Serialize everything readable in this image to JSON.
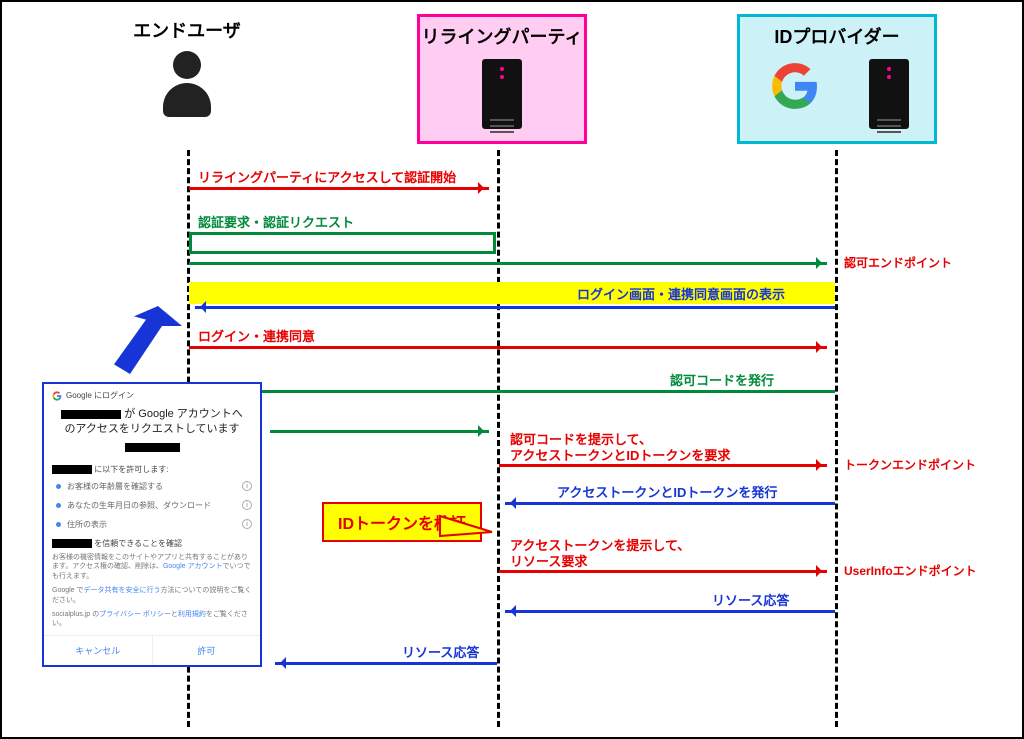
{
  "actors": {
    "user": "エンドユーザ",
    "rp": "リライングパーティ",
    "idp": "IDプロバイダー"
  },
  "messages": {
    "m1": "リライングパーティにアクセスして認証開始",
    "m2": "認証要求・認証リクエスト",
    "m3": "ログイン画面・連携同意画面の表示",
    "m4": "ログイン・連携同意",
    "m5": "認可コードを発行",
    "m6a": "認可コードを提示して、",
    "m6b": "アクセストークンとIDトークンを要求",
    "m7": "アクセストークンとIDトークンを発行",
    "m8a": "アクセストークンを提示して、",
    "m8b": "リソース要求",
    "m9": "リソース応答",
    "m10": "リソース応答"
  },
  "callout": "IDトークンを検証",
  "endpoints": {
    "authz": "認可エンドポイント",
    "token": "トークンエンドポイント",
    "userinfo": "UserInfoエンドポイント"
  },
  "consent": {
    "header": "Google にログイン",
    "headline_mid": " が Google アカウントへのアクセスをリクエストしています",
    "perm_head_suffix": " に以下を許可します:",
    "perms": {
      "p1": "お客様の年齢層を確認する",
      "p2": "あなたの生年月日の参照、ダウンロード",
      "p3": "住所の表示"
    },
    "trust_head_suffix": " を信頼できることを確認",
    "fineprint1_a": "お客様の機密情報をこのサイトやアプリと共有することがあります。アクセス権の確認、削除は、",
    "fineprint1_link": "Google アカウント",
    "fineprint1_b": "でいつでも行えます。",
    "fineprint2_a": "Google で",
    "fineprint2_link": "データ共有を安全に行う",
    "fineprint2_b": "方法についての説明をご覧ください。",
    "fineprint3_a": "socialplus.jp の",
    "fineprint3_link1": "プライバシー ポリシー",
    "fineprint3_mid": "と",
    "fineprint3_link2": "利用規約",
    "fineprint3_b": "をご覧ください。",
    "cancel": "キャンセル",
    "allow": "許可"
  }
}
